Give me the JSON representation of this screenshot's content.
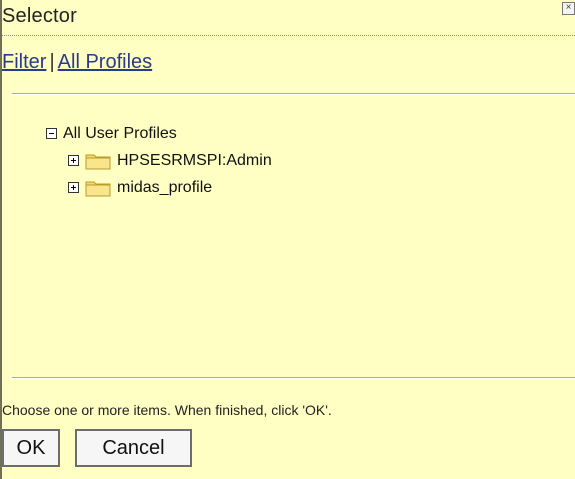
{
  "dialog": {
    "title": "Selector",
    "close_glyph": "×"
  },
  "links": {
    "filter": "Filter",
    "separator": "|",
    "all_profiles": "All Profiles"
  },
  "tree": {
    "root": {
      "label": "All User Profiles",
      "expanded": true,
      "icon": "minus-expander-icon"
    },
    "children": [
      {
        "label": "HPSESRMSPI:Admin",
        "icon": "folder-icon",
        "expander": "plus-expander-icon"
      },
      {
        "label": "midas_profile",
        "icon": "folder-icon",
        "expander": "plus-expander-icon"
      }
    ]
  },
  "footer": {
    "instruction": "Choose one or more items. When finished, click 'OK'.",
    "ok_label": "OK",
    "cancel_label": "Cancel"
  },
  "colors": {
    "background": "#ffffc4",
    "link": "#2b3a8a",
    "folder": "#f6d867"
  }
}
